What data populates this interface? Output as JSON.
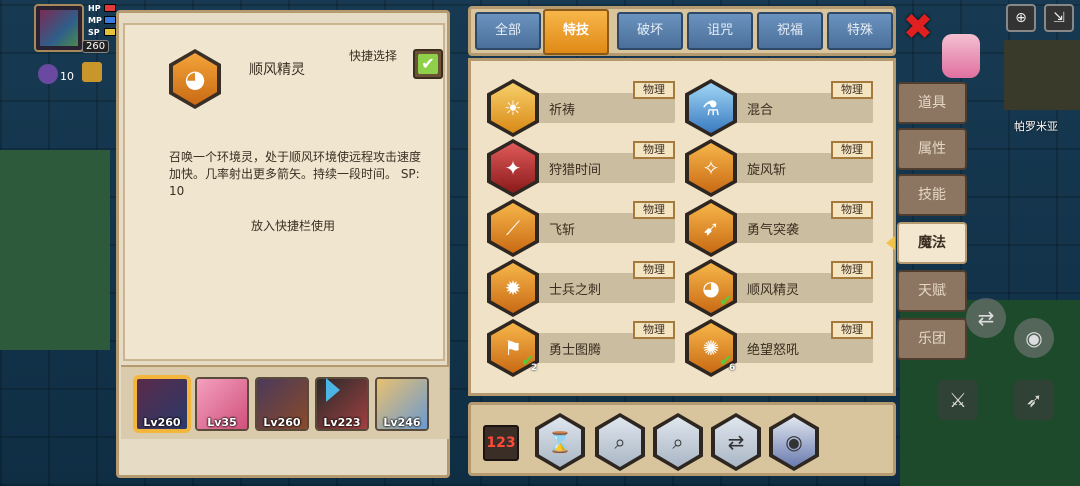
{
  "hud": {
    "hp_label": "HP",
    "mp_label": "MP",
    "sp_label": "SP",
    "level": "260",
    "buff_count": "10",
    "location": "帕罗米亚"
  },
  "detail": {
    "name": "顺风精灵",
    "quick_select_label": "快捷选择",
    "description": "召唤一个环境灵，处于顺风环境使远程攻击速度加快。几率射出更多箭矢。持续一段时间。  SP: 10",
    "add_button": "放入快捷栏使用"
  },
  "characters": [
    {
      "level": "Lv260"
    },
    {
      "level": "Lv35"
    },
    {
      "level": "Lv260"
    },
    {
      "level": "Lv223"
    },
    {
      "level": "Lv246"
    }
  ],
  "tabs": [
    "全部",
    "特技",
    "破坏",
    "诅咒",
    "祝福",
    "特殊"
  ],
  "skills": [
    {
      "name": "祈祷",
      "tag": "物理"
    },
    {
      "name": "混合",
      "tag": "物理"
    },
    {
      "name": "狩猎时间",
      "tag": "物理"
    },
    {
      "name": "旋风斩",
      "tag": "物理"
    },
    {
      "name": "飞斩",
      "tag": "物理"
    },
    {
      "name": "勇气突袭",
      "tag": "物理"
    },
    {
      "name": "士兵之刺",
      "tag": "物理"
    },
    {
      "name": "顺风精灵",
      "tag": "物理"
    },
    {
      "name": "勇士图腾",
      "tag": "物理",
      "count": "2"
    },
    {
      "name": "绝望怒吼",
      "tag": "物理",
      "count": "6"
    }
  ],
  "quickbar": {
    "page_indicator": "123"
  },
  "side_tabs": [
    "道具",
    "属性",
    "技能",
    "魔法",
    "天赋",
    "乐团"
  ]
}
